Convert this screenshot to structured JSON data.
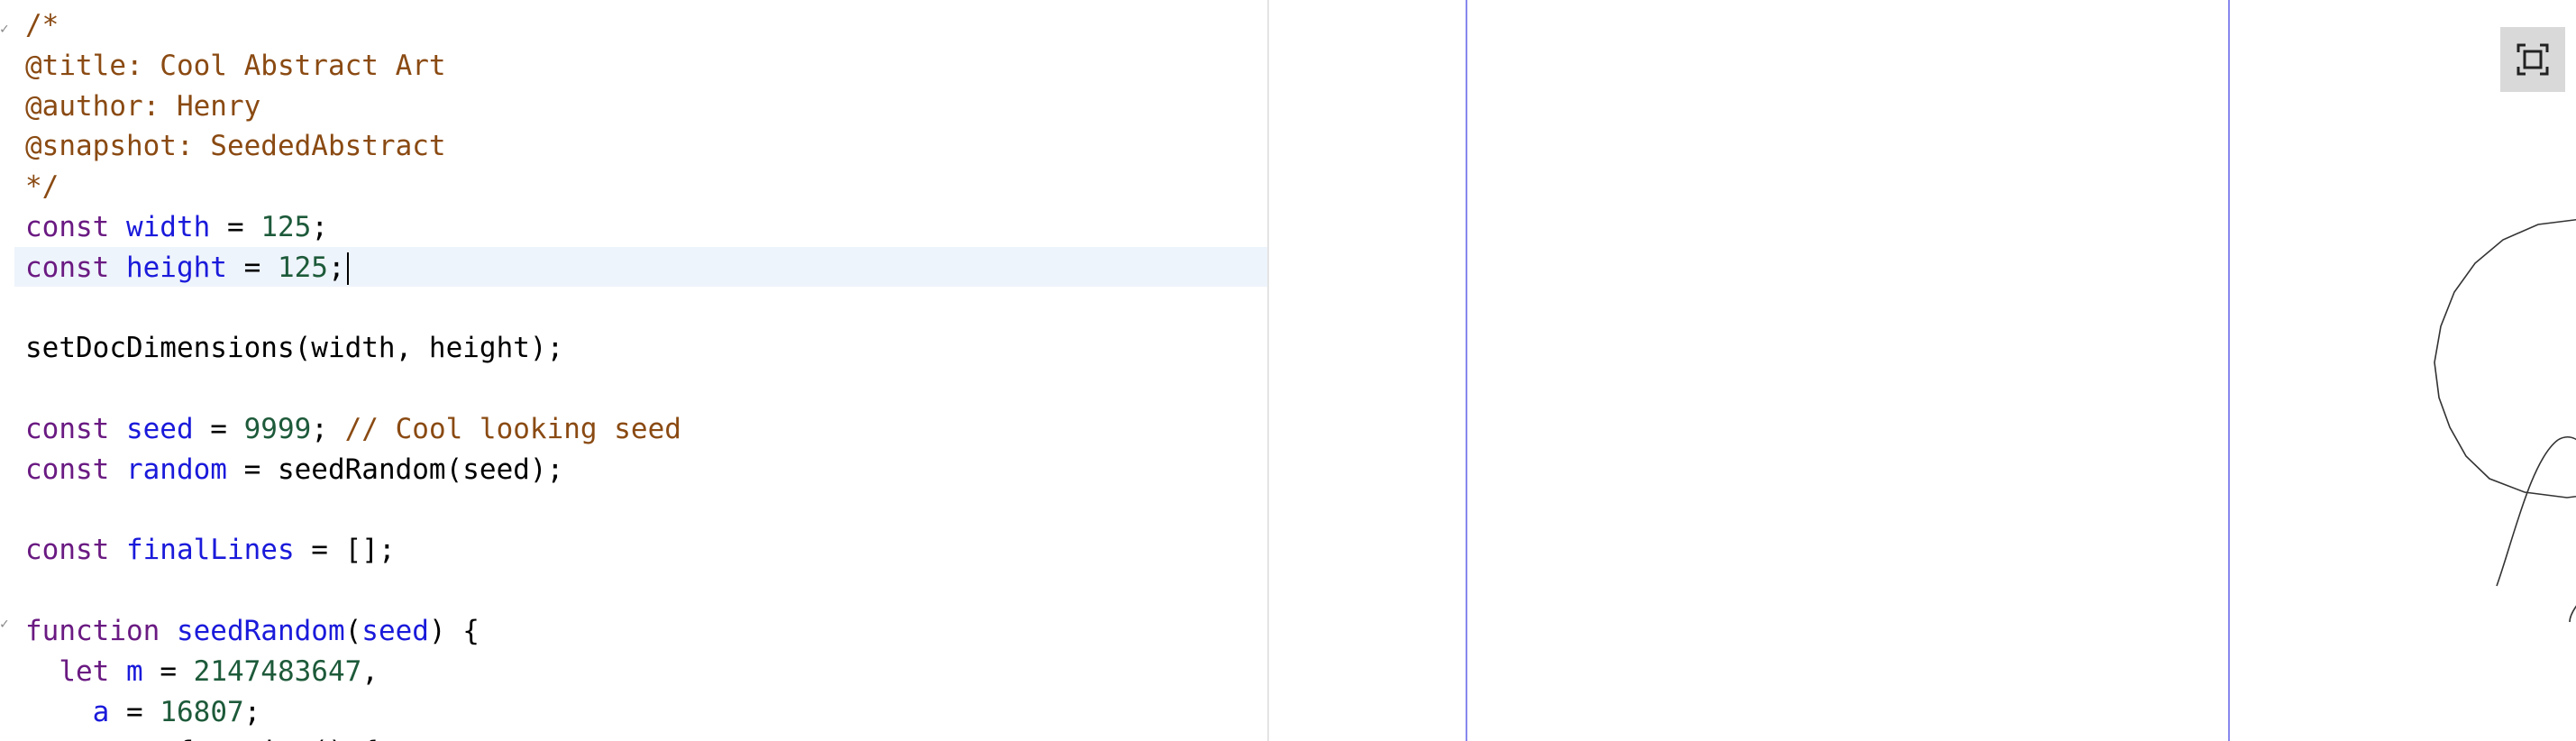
{
  "editor": {
    "lines": [
      [
        {
          "t": "/*",
          "c": "c"
        }
      ],
      [
        {
          "t": "@title: Cool Abstract Art",
          "c": "c"
        }
      ],
      [
        {
          "t": "@author: Henry",
          "c": "c"
        }
      ],
      [
        {
          "t": "@snapshot: SeededAbstract",
          "c": "c"
        }
      ],
      [
        {
          "t": "*/",
          "c": "c"
        }
      ],
      [
        {
          "t": "const ",
          "c": "k"
        },
        {
          "t": "width",
          "c": "v"
        },
        {
          "t": " = ",
          "c": "p"
        },
        {
          "t": "125",
          "c": "n"
        },
        {
          "t": ";",
          "c": "p"
        }
      ],
      [
        {
          "t": "const ",
          "c": "k"
        },
        {
          "t": "height",
          "c": "v"
        },
        {
          "t": " = ",
          "c": "p"
        },
        {
          "t": "125",
          "c": "n"
        },
        {
          "t": ";",
          "c": "p"
        }
      ],
      [],
      [
        {
          "t": "setDocDimensions(width, height);",
          "c": "p"
        }
      ],
      [],
      [
        {
          "t": "const ",
          "c": "k"
        },
        {
          "t": "seed",
          "c": "v"
        },
        {
          "t": " = ",
          "c": "p"
        },
        {
          "t": "9999",
          "c": "n"
        },
        {
          "t": "; ",
          "c": "p"
        },
        {
          "t": "// Cool looking seed",
          "c": "c"
        }
      ],
      [
        {
          "t": "const ",
          "c": "k"
        },
        {
          "t": "random",
          "c": "v"
        },
        {
          "t": " = seedRandom(seed);",
          "c": "p"
        }
      ],
      [],
      [
        {
          "t": "const ",
          "c": "k"
        },
        {
          "t": "finalLines",
          "c": "v"
        },
        {
          "t": " = [];",
          "c": "p"
        }
      ],
      [],
      [
        {
          "t": "function ",
          "c": "k"
        },
        {
          "t": "seedRandom",
          "c": "v"
        },
        {
          "t": "(",
          "c": "p"
        },
        {
          "t": "seed",
          "c": "v"
        },
        {
          "t": ") {",
          "c": "p"
        }
      ],
      [
        {
          "t": "  let ",
          "c": "k"
        },
        {
          "t": "m",
          "c": "v"
        },
        {
          "t": " = ",
          "c": "p"
        },
        {
          "t": "2147483647",
          "c": "n"
        },
        {
          "t": ",",
          "c": "p"
        }
      ],
      [
        {
          "t": "    ",
          "c": "p"
        },
        {
          "t": "a",
          "c": "v"
        },
        {
          "t": " = ",
          "c": "p"
        },
        {
          "t": "16807",
          "c": "n"
        },
        {
          "t": ";",
          "c": "p"
        }
      ],
      [
        {
          "t": "  return function() {",
          "c": "p"
        }
      ]
    ],
    "active_line": 6,
    "fold_markers": [
      0,
      15
    ]
  },
  "colors": {
    "comment": "#8a4a12",
    "keyword": "#6a1a82",
    "variable": "#1a1adb",
    "number": "#1d5a3a",
    "canvas_border": "#8888ee"
  },
  "preview": {
    "fullscreen_icon": "fullscreen-icon"
  }
}
